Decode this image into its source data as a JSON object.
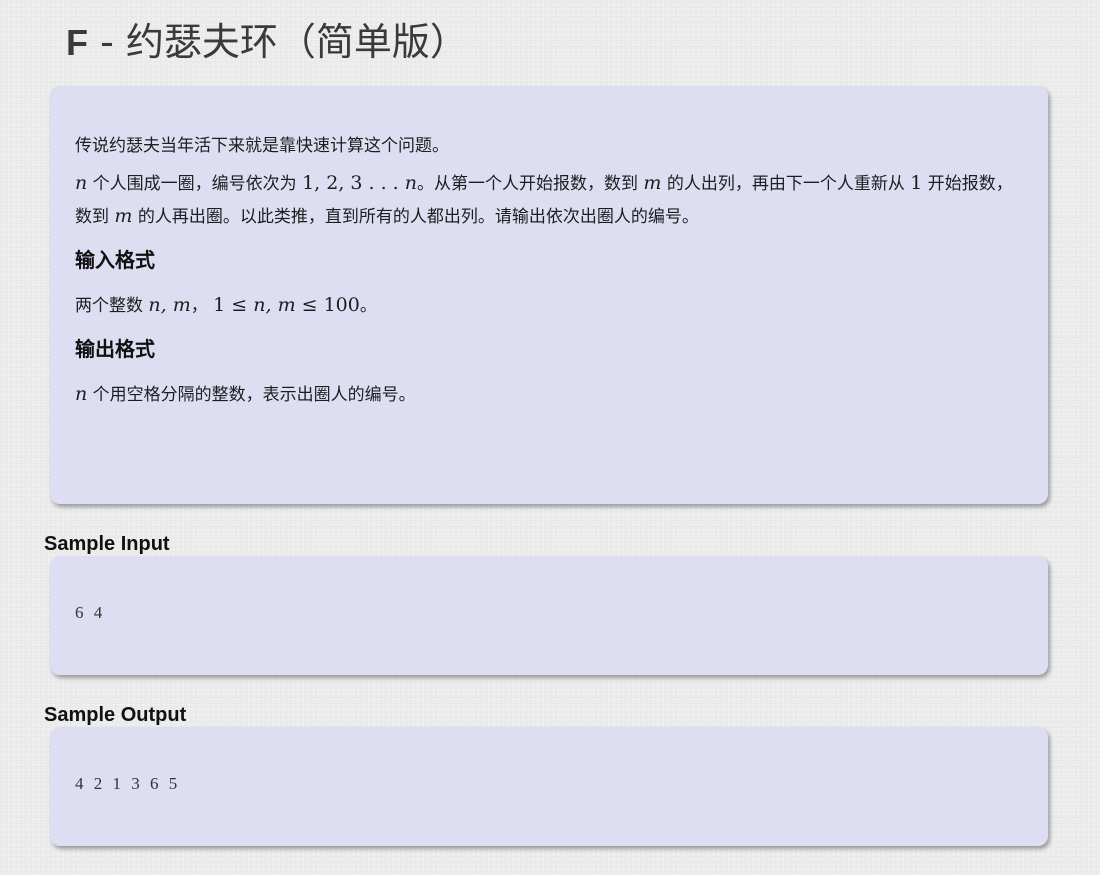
{
  "problem": {
    "title_letter": "F",
    "title_sep": " - ",
    "title_name": "约瑟夫环（简单版）"
  },
  "description": {
    "intro": "传说约瑟夫当年活下来就是靠快速计算这个问题。",
    "p2_var_n": "n",
    "p2_t1": " 个人围成一圈，编号依次为 ",
    "p2_seq": "1, 2, 3 . . . ",
    "p2_var_n_end": "n",
    "p2_t2": "。从第一个人开始报数，数到 ",
    "p2_var_m": "m",
    "p2_t3": " 的人出列，再由下一个人重新从 ",
    "p2_one": "1",
    "p2_t4": " 开始报数，数到 ",
    "p2_var_m2": "m",
    "p2_t5": " 的人再出圈。以此类推，直到所有的人都出列。请输出依次出圈人的编号。"
  },
  "input_format": {
    "heading": "输入格式",
    "t1": "两个整数 ",
    "vars": "n, m",
    "t2": "， ",
    "range_lo": "1 ≤ ",
    "range_vars": "n, m",
    "range_hi": " ≤ 100",
    "t3": "。"
  },
  "output_format": {
    "heading": "输出格式",
    "var_n": "n",
    "text": " 个用空格分隔的整数，表示出圈人的编号。"
  },
  "sample_input": {
    "label": "Sample Input",
    "content": "6 4"
  },
  "sample_output": {
    "label": "Sample Output",
    "content": "4 2 1 3 6 5"
  }
}
